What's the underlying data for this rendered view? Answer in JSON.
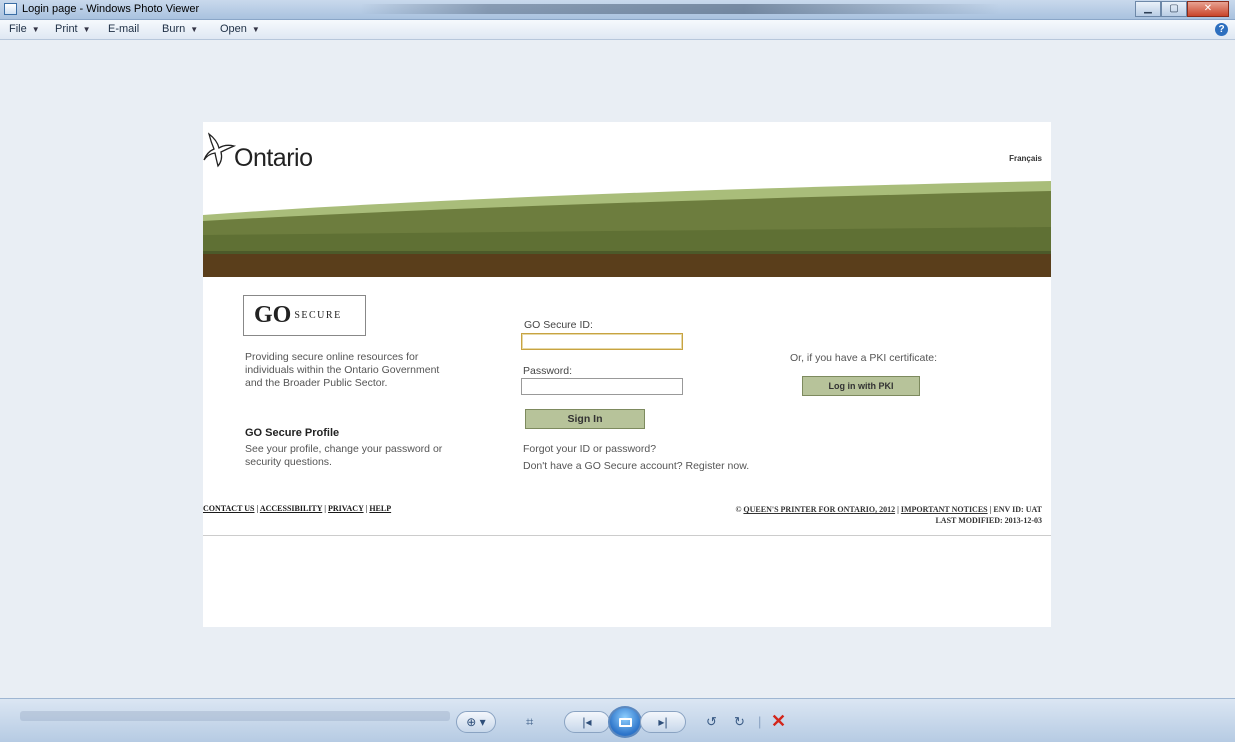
{
  "window": {
    "title": "Login page - Windows Photo Viewer",
    "controls": [
      "minimize",
      "maximize",
      "close"
    ]
  },
  "menubar": {
    "items": [
      {
        "label": "File",
        "has_dropdown": true
      },
      {
        "label": "Print",
        "has_dropdown": true
      },
      {
        "label": "E-mail",
        "has_dropdown": false
      },
      {
        "label": "Burn",
        "has_dropdown": true
      },
      {
        "label": "Open",
        "has_dropdown": true
      }
    ],
    "help_icon": "help-icon"
  },
  "page": {
    "brand": "Ontario",
    "language_link": "Français",
    "product": {
      "go": "GO",
      "secure": "SECURE"
    },
    "description": "Providing secure online resources for individuals within the Ontario Government and the Broader Public Sector.",
    "profile_heading": "GO Secure Profile",
    "profile_text": "See your profile, change your password or security questions.",
    "form": {
      "id_label": "GO Secure ID:",
      "id_value": "",
      "password_label": "Password:",
      "password_value": "",
      "signin_label": "Sign In",
      "forgot_link": "Forgot your ID or password?",
      "register_text": "Don't have a GO Secure account? Register now."
    },
    "pki": {
      "label": "Or, if you have a PKI certificate:",
      "button": "Log in with PKI"
    },
    "footer": {
      "links": [
        "CONTACT US",
        "ACCESSIBILITY",
        "PRIVACY",
        "HELP"
      ],
      "copyright_prefix": "©",
      "copyright_link": "QUEEN'S PRINTER FOR ONTARIO, 2012",
      "notices_link": "IMPORTANT NOTICES",
      "env": "ENV ID: UAT",
      "last_modified": "LAST MODIFIED: 2013-12-03"
    },
    "colors": {
      "banner_green": "#5f7034",
      "banner_light": "#a9bd7a",
      "banner_brown": "#5a3e1b",
      "button_green": "#b7c39a"
    }
  },
  "toolbar": {
    "buttons": [
      "zoom-icon",
      "actual-size-icon",
      "previous-icon",
      "slideshow-icon",
      "next-icon",
      "rotate-counterclockwise-icon",
      "rotate-clockwise-icon",
      "delete-icon"
    ]
  }
}
